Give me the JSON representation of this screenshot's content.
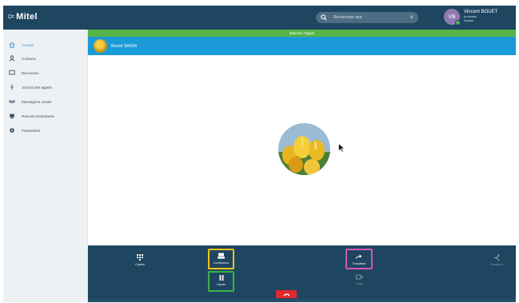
{
  "app": {
    "logo_mark": "D=",
    "logo_text": "Mitel"
  },
  "search": {
    "placeholder": "Rechercher tout",
    "clear_glyph": "×"
  },
  "user": {
    "initials": "VB",
    "name": "Vincent BOUET",
    "status": "Au bureau",
    "mood": "Surpise",
    "presence_color": "#4fb34f"
  },
  "sidebar": {
    "items": [
      {
        "label": "Accueil",
        "icon": "home-icon",
        "active": true
      },
      {
        "label": "Contacts",
        "icon": "person-icon",
        "active": false
      },
      {
        "label": "Discussion",
        "icon": "chat-icon",
        "active": false
      },
      {
        "label": "Journal des appels",
        "icon": "call-log-icon",
        "active": false
      },
      {
        "label": "Messagerie vocale",
        "icon": "voicemail-icon",
        "active": false
      },
      {
        "label": "Réunion instantanée",
        "icon": "meeting-icon",
        "active": false
      },
      {
        "label": "Paramètres",
        "icon": "gear-icon",
        "active": false
      }
    ]
  },
  "call": {
    "banner": "Maintien l'appel",
    "contact_name": "Benoit SIMON"
  },
  "controls": {
    "keypad": "Clavier",
    "conference": "Conférence",
    "hold": "Garde",
    "transfer": "Transférer",
    "video": "Vidéo",
    "disabled_right": "Transférer"
  },
  "colors": {
    "topbar": "#1f4660",
    "banner": "#58b346",
    "contact_bar": "#1a9ad6",
    "hangup": "#e1282d",
    "highlight_yellow": "#f5c21b",
    "highlight_green": "#3fb24a",
    "highlight_magenta": "#d259b8"
  }
}
